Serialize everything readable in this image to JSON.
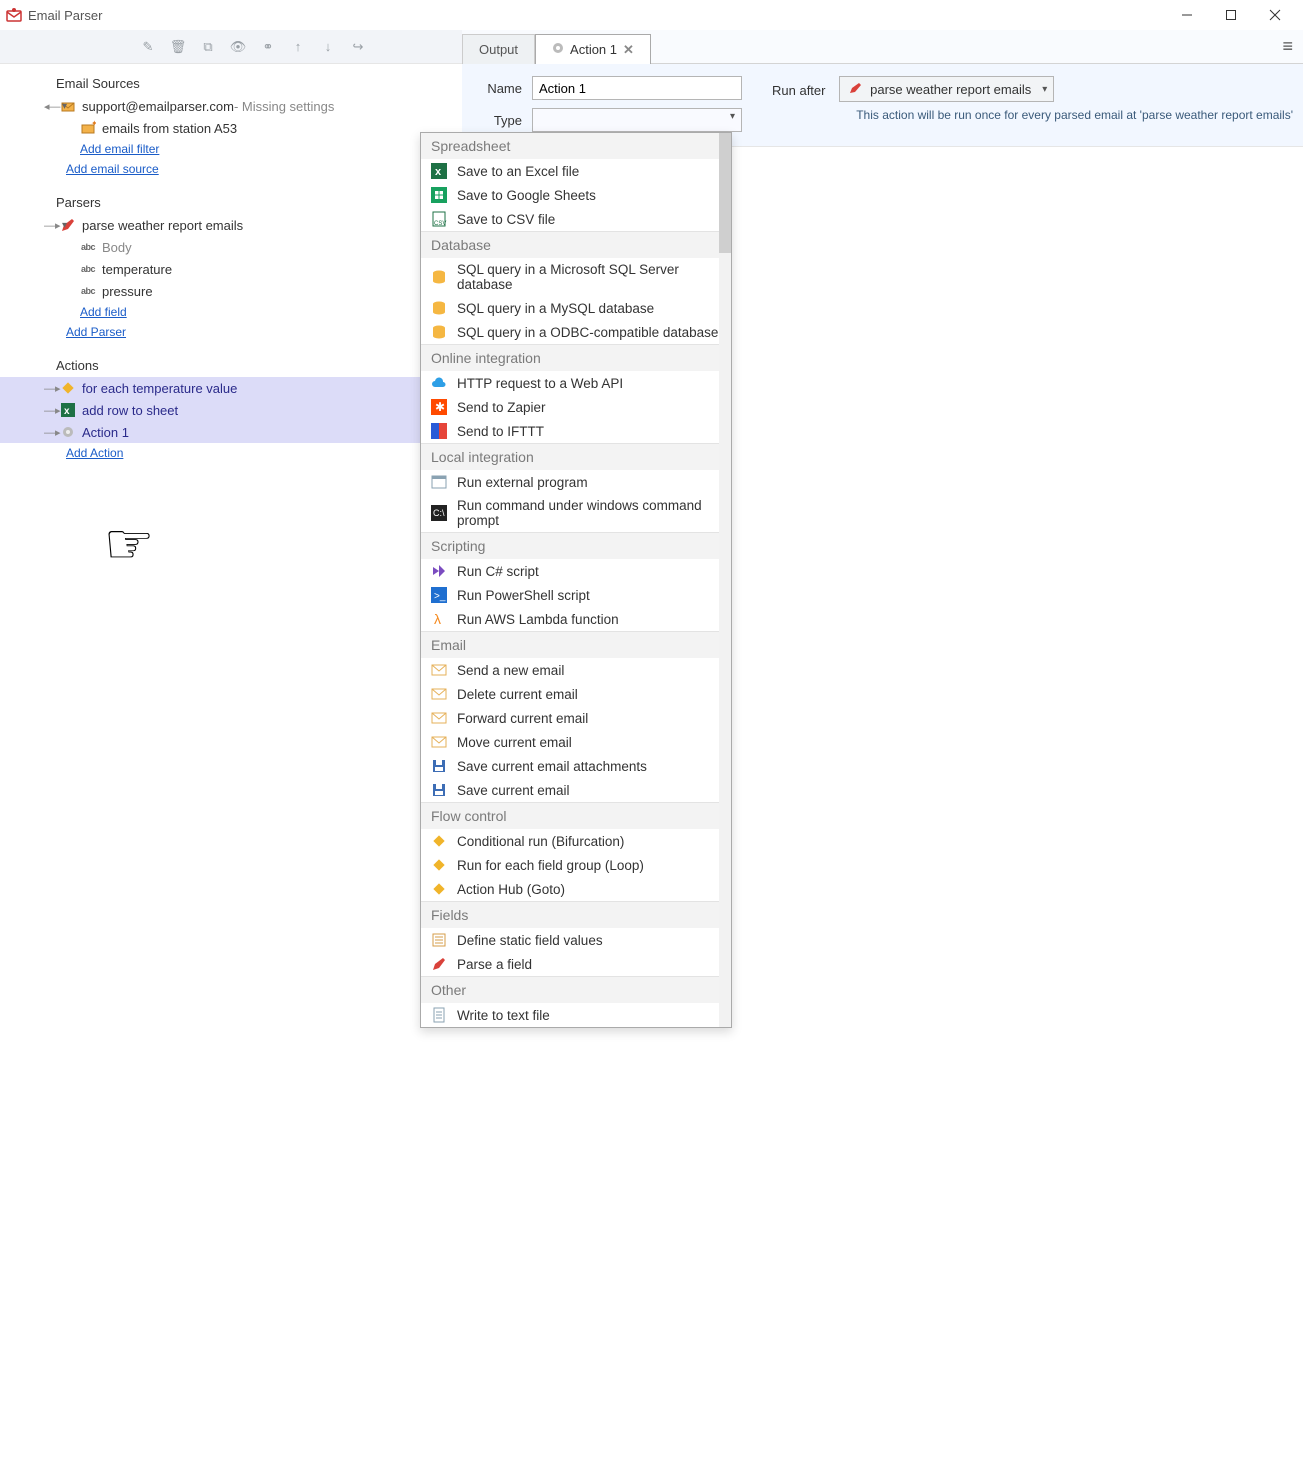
{
  "app": {
    "title": "Email Parser"
  },
  "left": {
    "sections": {
      "sources": {
        "title": "Email Sources",
        "items": [
          {
            "label": "support@emailparser.com",
            "suffix": " - Missing settings"
          },
          {
            "label": "emails from station A53"
          }
        ],
        "add_filter": "Add email filter",
        "add_source": "Add email source"
      },
      "parsers": {
        "title": "Parsers",
        "items": [
          {
            "label": "parse weather report emails"
          },
          {
            "label": "Body"
          },
          {
            "label": "temperature"
          },
          {
            "label": "pressure"
          }
        ],
        "add_field": "Add field",
        "add_parser": "Add Parser"
      },
      "actions": {
        "title": "Actions",
        "items": [
          {
            "label": "for each temperature value"
          },
          {
            "label": "add row to sheet"
          },
          {
            "label": "Action 1"
          }
        ],
        "add_action": "Add Action"
      }
    }
  },
  "tabs": {
    "output": "Output",
    "action": "Action 1"
  },
  "form": {
    "name_label": "Name",
    "name_value": "Action 1",
    "type_label": "Type",
    "runafter_label": "Run after",
    "runafter_value": "parse weather report emails",
    "runafter_note": "This action will be run once for every parsed email at 'parse weather report emails'"
  },
  "dropdown": [
    {
      "type": "section",
      "label": "Spreadsheet"
    },
    {
      "type": "item",
      "label": "Save to an Excel file",
      "icon": "excel",
      "color": "#1e7145"
    },
    {
      "type": "item",
      "label": "Save to Google Sheets",
      "icon": "gsheets",
      "color": "#18a15f"
    },
    {
      "type": "item",
      "label": "Save to CSV file",
      "icon": "csv",
      "color": "#1e7145"
    },
    {
      "type": "section",
      "label": "Database"
    },
    {
      "type": "item",
      "label": "SQL query in a Microsoft SQL Server database",
      "icon": "db",
      "color": "#f5b742"
    },
    {
      "type": "item",
      "label": "SQL query in a MySQL database",
      "icon": "db",
      "color": "#f5b742"
    },
    {
      "type": "item",
      "label": "SQL query in a ODBC-compatible database",
      "icon": "db",
      "color": "#f5b742"
    },
    {
      "type": "section",
      "label": "Online integration"
    },
    {
      "type": "item",
      "label": "HTTP request to a Web API",
      "icon": "cloud",
      "color": "#2e9fe6"
    },
    {
      "type": "item",
      "label": "Send to Zapier",
      "icon": "zapier",
      "color": "#ff4a00"
    },
    {
      "type": "item",
      "label": "Send to IFTTT",
      "icon": "ifttt",
      "color": "#2a5bd7"
    },
    {
      "type": "section",
      "label": "Local integration"
    },
    {
      "type": "item",
      "label": "Run external program",
      "icon": "window",
      "color": "#8aa2b2"
    },
    {
      "type": "item",
      "label": "Run command under windows command prompt",
      "icon": "cmd",
      "color": "#222"
    },
    {
      "type": "section",
      "label": "Scripting"
    },
    {
      "type": "item",
      "label": "Run C# script",
      "icon": "vs",
      "color": "#7b4cc0"
    },
    {
      "type": "item",
      "label": "Run PowerShell script",
      "icon": "ps",
      "color": "#1f6fd0"
    },
    {
      "type": "item",
      "label": "Run AWS Lambda function",
      "icon": "lambda",
      "color": "#f58a1f"
    },
    {
      "type": "section",
      "label": "Email"
    },
    {
      "type": "item",
      "label": "Send a new email",
      "icon": "mail",
      "color": "#e6b15a"
    },
    {
      "type": "item",
      "label": "Delete current email",
      "icon": "mail-del",
      "color": "#e6b15a"
    },
    {
      "type": "item",
      "label": "Forward current email",
      "icon": "mail-fwd",
      "color": "#e6b15a"
    },
    {
      "type": "item",
      "label": "Move current email",
      "icon": "mail-move",
      "color": "#e6b15a"
    },
    {
      "type": "item",
      "label": "Save current email attachments",
      "icon": "save",
      "color": "#3d6db5"
    },
    {
      "type": "item",
      "label": "Save current email",
      "icon": "mail-save",
      "color": "#3d6db5"
    },
    {
      "type": "section",
      "label": "Flow control"
    },
    {
      "type": "item",
      "label": "Conditional run (Bifurcation)",
      "icon": "diamond",
      "color": "#f0b42a"
    },
    {
      "type": "item",
      "label": "Run for each field group (Loop)",
      "icon": "diamond",
      "color": "#f0b42a"
    },
    {
      "type": "item",
      "label": "Action Hub (Goto)",
      "icon": "diamond",
      "color": "#f0b42a"
    },
    {
      "type": "section",
      "label": "Fields"
    },
    {
      "type": "item",
      "label": "Define static field values",
      "icon": "list",
      "color": "#d69d4a"
    },
    {
      "type": "item",
      "label": "Parse a field",
      "icon": "pen",
      "color": "#d9413a"
    },
    {
      "type": "section",
      "label": "Other"
    },
    {
      "type": "item",
      "label": "Write to text file",
      "icon": "txt",
      "color": "#8aa2b2"
    }
  ]
}
